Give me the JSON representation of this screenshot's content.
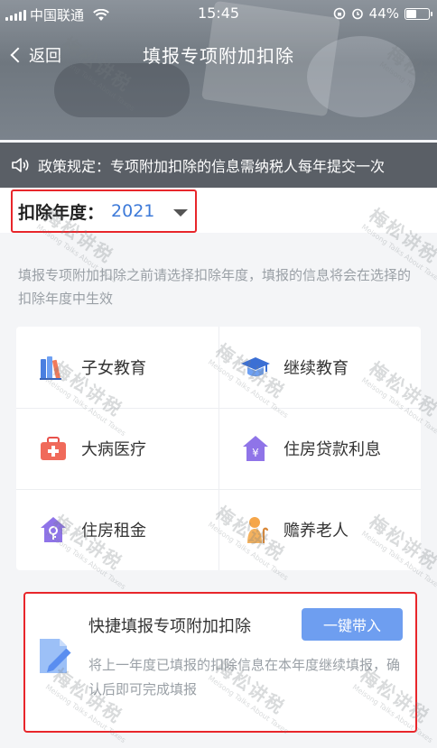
{
  "status": {
    "carrier": "中国联通",
    "time": "15:45",
    "battery": "44%",
    "battery_level": 0.44
  },
  "nav": {
    "back_label": "返回",
    "title": "填报专项附加扣除"
  },
  "notice": {
    "text": "政策规定：专项附加扣除的信息需纳税人每年提交一次"
  },
  "year": {
    "label": "扣除年度：",
    "value": "2021"
  },
  "hint": "填报专项附加扣除之前请选择扣除年度，填报的信息将会在选择的扣除年度中生效",
  "categories": [
    {
      "label": "子女教育",
      "icon": "books-icon"
    },
    {
      "label": "继续教育",
      "icon": "graduation-cap-icon"
    },
    {
      "label": "大病医疗",
      "icon": "medical-kit-icon"
    },
    {
      "label": "住房贷款利息",
      "icon": "house-yen-icon"
    },
    {
      "label": "住房租金",
      "icon": "house-key-icon"
    },
    {
      "label": "赡养老人",
      "icon": "elderly-icon"
    }
  ],
  "quick": {
    "title": "快捷填报专项附加扣除",
    "button": "一键带入",
    "desc": "将上一年度已填报的扣除信息在本年度继续填报，确认后即可完成填报"
  },
  "watermark": {
    "text": "梅松讲税",
    "subtext": "Meisong Talks About Taxes"
  },
  "colors": {
    "accent": "#3d7ad9",
    "button": "#6e9ef0",
    "highlight": "#e8262b"
  }
}
